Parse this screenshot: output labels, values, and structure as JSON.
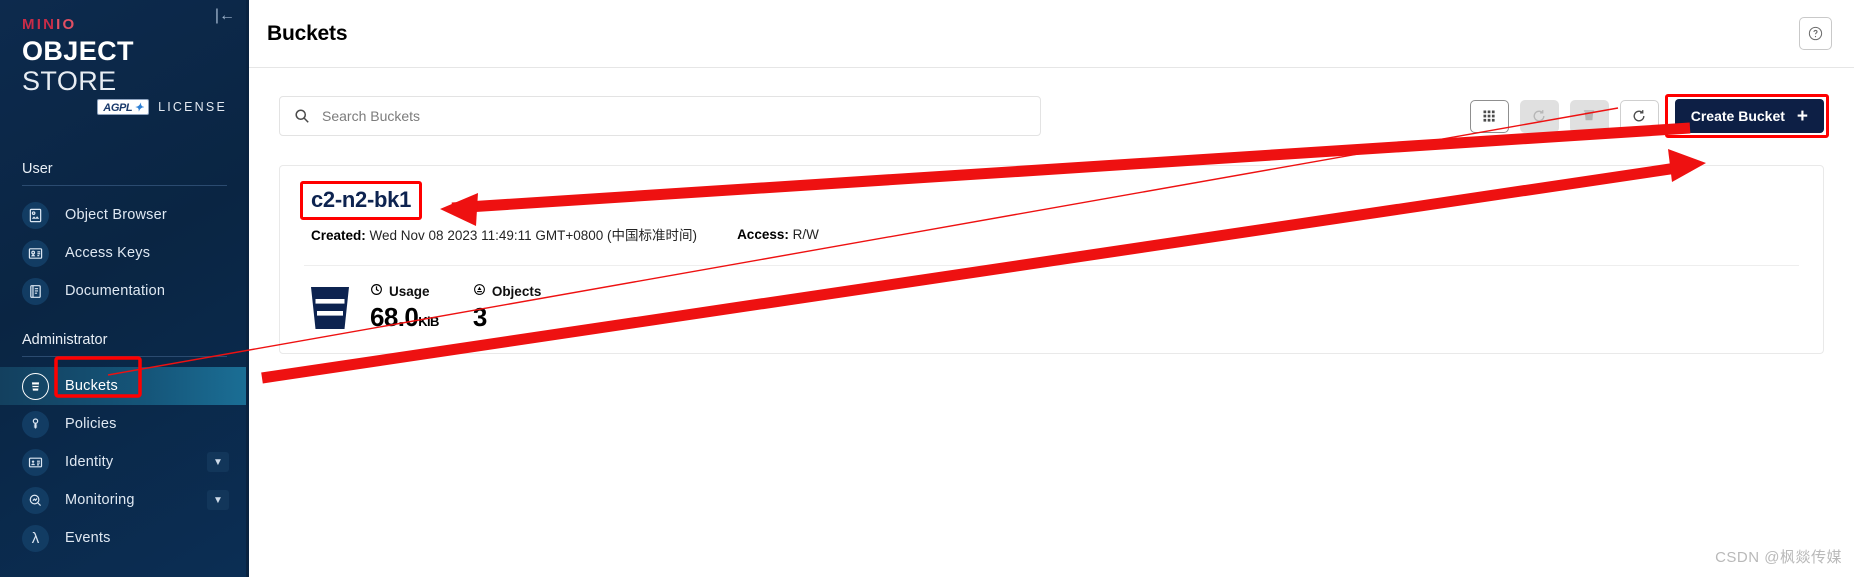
{
  "brand": {
    "minio": "MIN",
    "minio_suffix": "IO",
    "object": "OBJECT",
    "store": " STORE",
    "agpl": "AGPL",
    "license": "LICENSE",
    "collapse_icon": "collapse-sidebar-icon"
  },
  "sidebar": {
    "sections": [
      {
        "label": "User",
        "items": [
          {
            "label": "Object Browser",
            "icon": "object-browser-icon",
            "active": false,
            "expandable": false
          },
          {
            "label": "Access Keys",
            "icon": "access-keys-icon",
            "active": false,
            "expandable": false
          },
          {
            "label": "Documentation",
            "icon": "documentation-icon",
            "active": false,
            "expandable": false
          }
        ]
      },
      {
        "label": "Administrator",
        "items": [
          {
            "label": "Buckets",
            "icon": "buckets-icon",
            "active": true,
            "expandable": false
          },
          {
            "label": "Policies",
            "icon": "policies-icon",
            "active": false,
            "expandable": false
          },
          {
            "label": "Identity",
            "icon": "identity-icon",
            "active": false,
            "expandable": true
          },
          {
            "label": "Monitoring",
            "icon": "monitoring-icon",
            "active": false,
            "expandable": true
          },
          {
            "label": "Events",
            "icon": "events-lambda-icon",
            "active": false,
            "expandable": false
          }
        ]
      }
    ]
  },
  "header": {
    "title": "Buckets",
    "help_icon": "help-question-icon"
  },
  "search": {
    "placeholder": "Search Buckets",
    "value": "",
    "icon": "search-icon"
  },
  "toolbar": {
    "buttons": [
      {
        "name": "grid-view-button",
        "icon": "grid-icon",
        "state": "selected"
      },
      {
        "name": "lifecycle-button",
        "icon": "lifecycle-refresh-icon",
        "state": "disabled"
      },
      {
        "name": "delete-selected-button",
        "icon": "trash-icon",
        "state": "disabled"
      },
      {
        "name": "refresh-button",
        "icon": "refresh-icon",
        "state": "enabled"
      }
    ],
    "create_label": "Create Bucket",
    "create_plus": "+"
  },
  "bucket": {
    "name": "c2-n2-bk1",
    "created_label": "Created:",
    "created_value": "Wed Nov 08 2023 11:49:11 GMT+0800 (中国标准时间)",
    "access_label": "Access:",
    "access_value": "R/W",
    "usage_label": "Usage",
    "usage_value": "68.0",
    "usage_unit": "KiB",
    "objects_label": "Objects",
    "objects_value": "3",
    "usage_icon": "clock-icon",
    "objects_icon": "objects-icon",
    "bucket_icon": "bucket-glyph-icon"
  },
  "annotations": {
    "highlight_color": "#ff0000",
    "arrow_color": "#ee1111",
    "boxes": [
      "bucket-name-highlight",
      "create-bucket-highlight",
      "sidebar-buckets-highlight"
    ],
    "arrows": [
      "arrow-to-bucket-name",
      "arrow-to-create-bucket"
    ]
  },
  "watermark": {
    "text": "CSDN @枫燚传媒"
  }
}
